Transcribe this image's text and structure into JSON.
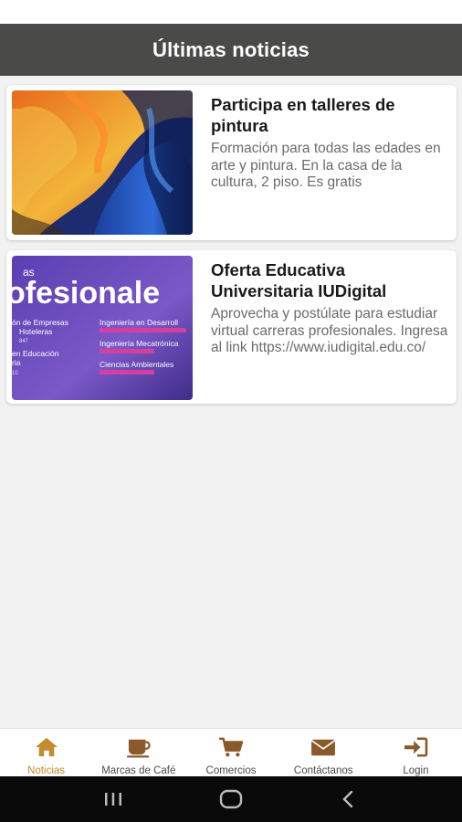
{
  "header": {
    "title": "Últimas noticias"
  },
  "news": [
    {
      "title": "Participa en talleres de pintura",
      "description": "Formación para todas las edades en arte y pintura. En la casa de la cultura, 2 piso. Es gratis"
    },
    {
      "title": "Oferta Educativa Universitaria IUDigital",
      "description": "Aprovecha y postúlate para estudiar virtual carreras profesionales. Ingresa al link https://www.iudigital.edu.co/",
      "thumb_text": {
        "big": "ofesionale",
        "top": "as",
        "left1": "ón de Empresas",
        "left2": "Hoteleras",
        "left3": "847",
        "left4": "en Educación",
        "left5": "ria",
        "left6": "10",
        "r1": "Ingeniería en Desarroll",
        "r2": "Ingeniería Mecatrónica",
        "r3": "Ciencias Ambientales"
      }
    }
  ],
  "bottom_nav": [
    {
      "label": "Noticias",
      "icon": "home-icon",
      "active": true
    },
    {
      "label": "Marcas de Café",
      "icon": "coffee-cup-icon",
      "active": false
    },
    {
      "label": "Comercios",
      "icon": "shopping-cart-icon",
      "active": false
    },
    {
      "label": "Contáctanos",
      "icon": "envelope-icon",
      "active": false
    },
    {
      "label": "Login",
      "icon": "login-icon",
      "active": false
    }
  ],
  "colors": {
    "header_bg": "#4a4a49",
    "accent": "#c48a2c",
    "icon_brown": "#8b5a2b"
  }
}
